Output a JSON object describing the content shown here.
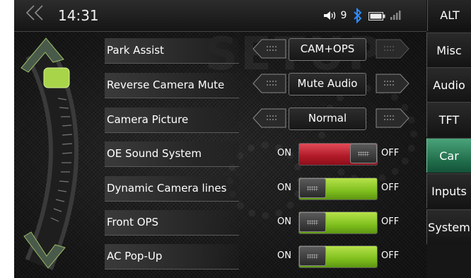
{
  "status_bar": {
    "time": "14:31",
    "volume": "9",
    "back_icon": "double-chevron-left-icon",
    "icons": [
      "volume-icon",
      "bluetooth-icon",
      "battery-icon",
      "signal-icon"
    ]
  },
  "alt_button": "ALT",
  "watermark": "SETUP",
  "settings": {
    "park_assist": {
      "label": "Park Assist",
      "value": "CAM+OPS"
    },
    "reverse_camera_mute": {
      "label": "Reverse Camera Mute",
      "value": "Mute Audio"
    },
    "camera_picture": {
      "label": "Camera Picture",
      "value": "Normal"
    },
    "oe_sound_system": {
      "label": "OE Sound System",
      "on": "ON",
      "off": "OFF",
      "state": "OFF"
    },
    "dynamic_camera_lines": {
      "label": "Dynamic Camera lines",
      "on": "ON",
      "off": "OFF",
      "state": "ON"
    },
    "front_ops": {
      "label": "Front OPS",
      "on": "ON",
      "off": "OFF",
      "state": "ON"
    },
    "ac_popup": {
      "label": "AC Pop-Up",
      "on": "ON",
      "off": "OFF",
      "state": "ON"
    }
  },
  "sidebar": {
    "items": [
      {
        "label": "Misc"
      },
      {
        "label": "Audio"
      },
      {
        "label": "TFT"
      },
      {
        "label": "Car",
        "active": true
      },
      {
        "label": "Inputs"
      },
      {
        "label": "System"
      }
    ]
  },
  "colors": {
    "toggle_on": "#7fbf1e",
    "toggle_off": "#b01a28",
    "active_tab": "#2e8a5e",
    "dial_accent": "#a8d44a"
  }
}
